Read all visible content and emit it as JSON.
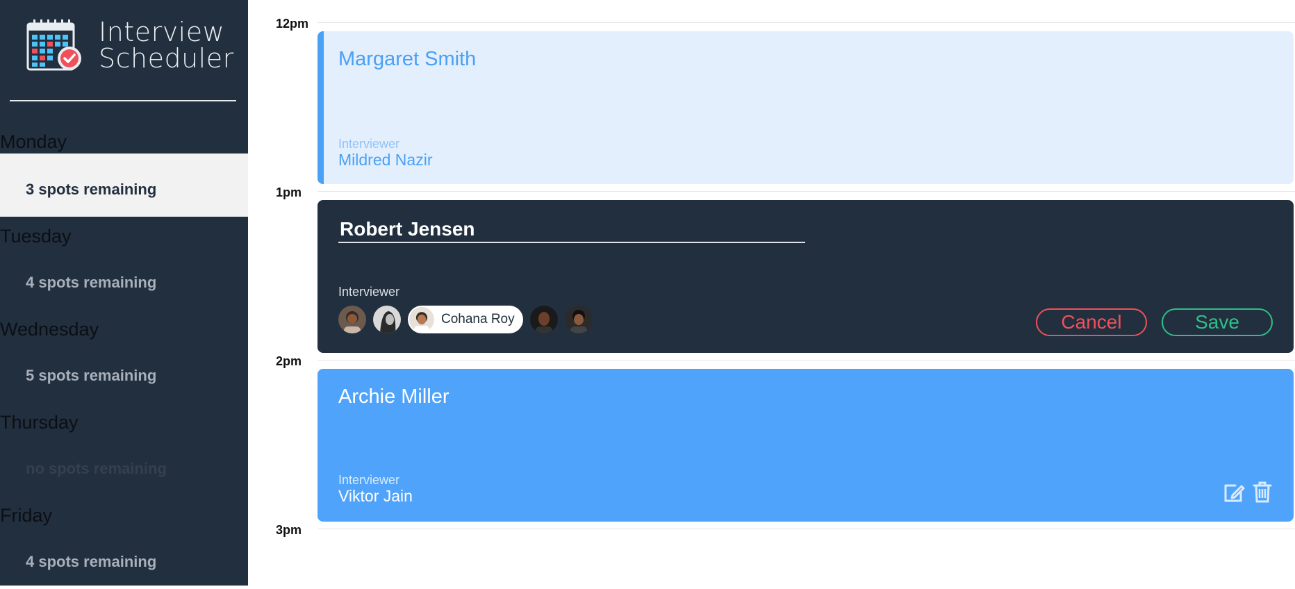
{
  "app": {
    "title_line1": "Interview",
    "title_line2": "Scheduler"
  },
  "days": [
    {
      "name": "Monday",
      "spots": "3 spots remaining",
      "selected": true
    },
    {
      "name": "Tuesday",
      "spots": "4 spots remaining",
      "selected": false
    },
    {
      "name": "Wednesday",
      "spots": "5 spots remaining",
      "selected": false
    },
    {
      "name": "Thursday",
      "spots": "no spots remaining",
      "selected": false
    },
    {
      "name": "Friday",
      "spots": "4 spots remaining",
      "selected": false
    }
  ],
  "times": [
    "12pm",
    "1pm",
    "2pm",
    "3pm"
  ],
  "appointments": {
    "noon": {
      "student": "Margaret Smith",
      "interviewer_label": "Interviewer",
      "interviewer": "Mildred Nazir"
    },
    "one": {
      "student_value": "Robert Jensen",
      "interviewer_label": "Interviewer",
      "selected_interviewer": "Cohana Roy",
      "cancel_label": "Cancel",
      "save_label": "Save"
    },
    "two": {
      "student": "Archie Miller",
      "interviewer_label": "Interviewer",
      "interviewer": "Viktor Jain"
    }
  },
  "colors": {
    "sidebar": "#222f3e",
    "accent_blue": "#50a3fa",
    "light_blue": "#e3effd",
    "danger": "#f0505a",
    "success": "#2fbf8b"
  },
  "icons": {
    "logo": "calendar-check-icon",
    "edit": "edit-icon",
    "delete": "trash-icon"
  }
}
